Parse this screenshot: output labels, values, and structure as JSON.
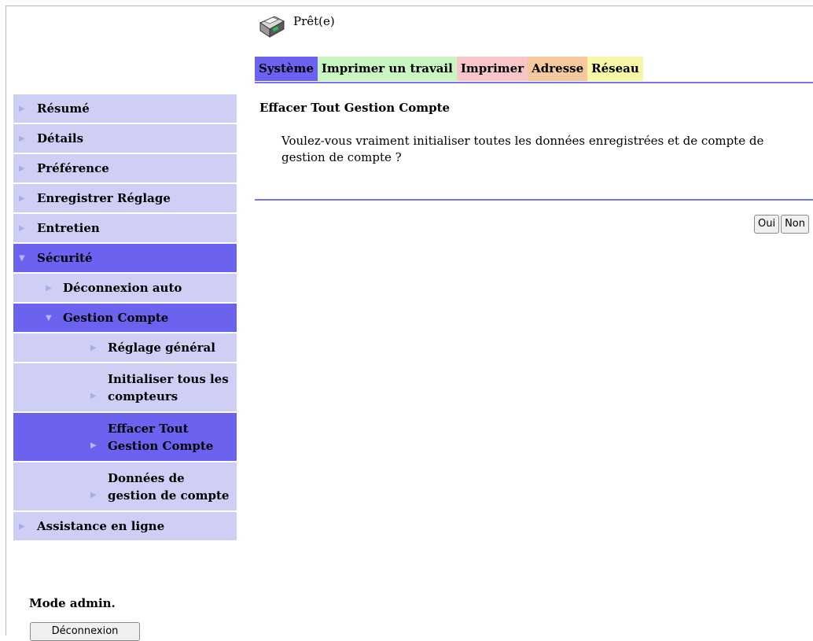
{
  "status": {
    "text": "Prêt(e)",
    "icon": "printer-icon"
  },
  "tabs": [
    {
      "label": "Système",
      "color": "#6b63f0"
    },
    {
      "label": "Imprimer un travail",
      "color": "#c8f5c0"
    },
    {
      "label": "Imprimer",
      "color": "#f6c6c8"
    },
    {
      "label": "Adresse",
      "color": "#f6c89e"
    },
    {
      "label": "Réseau",
      "color": "#f8f7a8"
    }
  ],
  "sidebar": {
    "items": [
      {
        "label": "Résumé"
      },
      {
        "label": "Détails"
      },
      {
        "label": "Préférence"
      },
      {
        "label": "Enregistrer Réglage"
      },
      {
        "label": "Entretien"
      },
      {
        "label": "Sécurité"
      },
      {
        "label": "Déconnexion auto"
      },
      {
        "label": "Gestion Compte"
      },
      {
        "label": "Réglage général"
      },
      {
        "label": "Initialiser tous les compteurs"
      },
      {
        "label": "Effacer Tout Gestion Compte"
      },
      {
        "label": "Données de gestion de compte"
      },
      {
        "label": "Assistance en ligne"
      }
    ]
  },
  "admin": {
    "mode_label": "Mode admin.",
    "logout_label": "Déconnexion"
  },
  "content": {
    "title": "Effacer Tout Gestion Compte",
    "message": "Voulez-vous vraiment initialiser toutes les données enregistrées et de compte de gestion de compte ?",
    "yes_label": "Oui",
    "no_label": "Non"
  },
  "colors": {
    "accent": "#6b63f0",
    "menu_bg": "#cfcff6"
  }
}
